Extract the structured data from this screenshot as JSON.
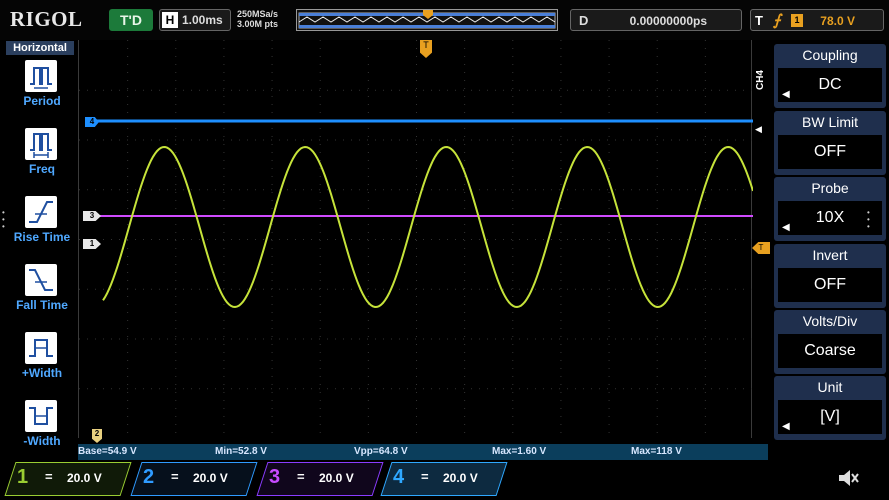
{
  "header": {
    "logo": "RIGOL",
    "run_status": "T'D",
    "timebase_badge": "H",
    "timebase": "1.00ms",
    "sample_rate": "250MSa/s",
    "memory_depth": "3.00M pts",
    "delay_badge": "D",
    "delay": "0.00000000ps",
    "trigger_label": "T",
    "trigger_source": "1",
    "trigger_level": "78.0 V"
  },
  "left_menu": {
    "title": "Horizontal",
    "items": [
      {
        "label": "Period",
        "icon": "period-icon"
      },
      {
        "label": "Freq",
        "icon": "freq-icon"
      },
      {
        "label": "Rise Time",
        "icon": "rise-time-icon"
      },
      {
        "label": "Fall Time",
        "icon": "fall-time-icon"
      },
      {
        "label": "+Width",
        "icon": "positive-width-icon"
      },
      {
        "label": "-Width",
        "icon": "negative-width-icon"
      }
    ]
  },
  "measurements": {
    "base": "Base=54.9 V",
    "min": "Min=52.8 V",
    "vpp": "Vpp=64.8 V",
    "max": "Max=1.60 V",
    "max2": "Max=118 V"
  },
  "channels": [
    {
      "num": "1",
      "scale": "20.0 V",
      "color": "#9acd32"
    },
    {
      "num": "2",
      "scale": "20.0 V",
      "color": "#2f9bff"
    },
    {
      "num": "3",
      "scale": "20.0 V",
      "color": "#c84bff"
    },
    {
      "num": "4",
      "scale": "20.0 V",
      "color": "#2fa8ff"
    }
  ],
  "right_menu": {
    "channel_label": "CH4",
    "items": [
      {
        "title": "Coupling",
        "value": "DC",
        "arrow": true
      },
      {
        "title": "BW Limit",
        "value": "OFF",
        "arrow": false
      },
      {
        "title": "Probe",
        "value": "10X",
        "arrow": true
      },
      {
        "title": "Invert",
        "value": "OFF",
        "arrow": false
      },
      {
        "title": "Volts/Div",
        "value": "Coarse",
        "arrow": false
      },
      {
        "title": "Unit",
        "value": "[V]",
        "arrow": true
      }
    ]
  },
  "markers": {
    "ch4_level": "4",
    "ch3_level": "3",
    "ch1_level": "1",
    "trigger_pos": "T",
    "trigger_level": "T",
    "ch2_ground": "2"
  },
  "colors": {
    "ch1": "#c6e33a",
    "ch2": "#2f9bff",
    "ch3": "#d04bff",
    "ch4": "#1e8fff",
    "trigger": "#e8a020",
    "menu_bg": "#1f2f4d",
    "label_blue": "#4fa8ff"
  }
}
